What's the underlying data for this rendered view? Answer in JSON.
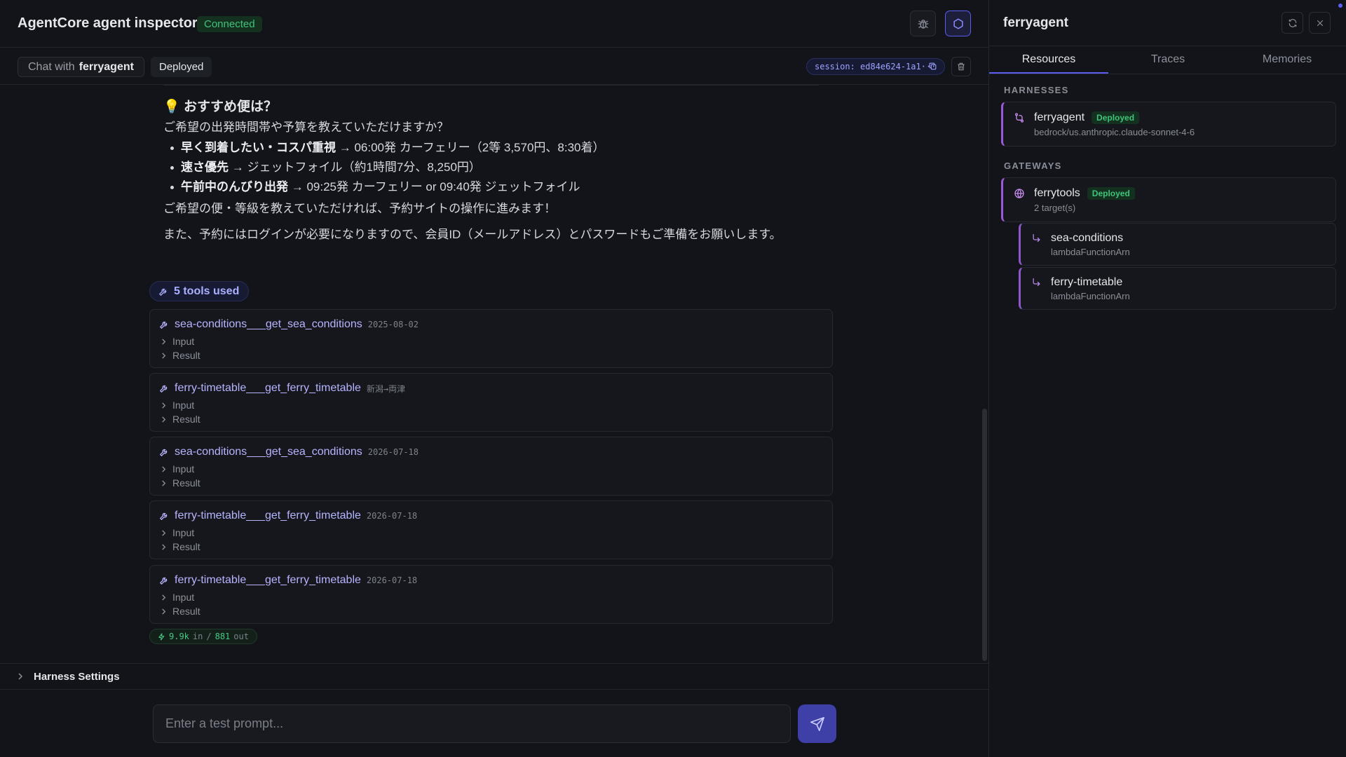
{
  "app": {
    "title": "AgentCore agent inspector",
    "status": "Connected"
  },
  "header": {
    "bug_icon": "bug-icon",
    "panel_icon": "hexagon-icon"
  },
  "chat_header": {
    "chat_with_label": "Chat with",
    "agent_name": "ferryagent",
    "deployed_label": "Deployed",
    "session": "session: ed84e624-1a1···"
  },
  "message": {
    "heading_emoji": "💡",
    "heading": "おすすめ便は？",
    "intro": "ご希望の出発時間帯や予算を教えていただけますか？",
    "options": [
      {
        "bold": "早く到着したい・コスパ重視",
        "rest": " → 06:00発 カーフェリー（2等 3,570円、8:30着）"
      },
      {
        "bold": "速さ優先",
        "rest": " → ジェットフォイル（約1時間7分、8,250円）"
      },
      {
        "bold": "午前中のんびり出発",
        "rest": " → 09:25発 カーフェリー or 09:40発 ジェットフォイル"
      }
    ],
    "followup": "ご希望の便・等級を教えていただければ、予約サイトの操作に進みます！",
    "login_note": "また、予約にはログインが必要になりますので、会員ID（メールアドレス）とパスワードもご準備をお願いします。"
  },
  "tools": {
    "summary": "5 tools used",
    "input_label": "Input",
    "result_label": "Result",
    "items": [
      {
        "name": "sea-conditions___get_sea_conditions",
        "arg": "2025-08-02"
      },
      {
        "name": "ferry-timetable___get_ferry_timetable",
        "arg": "新潟→両津"
      },
      {
        "name": "sea-conditions___get_sea_conditions",
        "arg": "2026-07-18"
      },
      {
        "name": "ferry-timetable___get_ferry_timetable",
        "arg": "2026-07-18"
      },
      {
        "name": "ferry-timetable___get_ferry_timetable",
        "arg": "2026-07-18"
      }
    ]
  },
  "tokens": {
    "in_value": "9.9k",
    "in_label": "in",
    "sep": "/",
    "out_value": "881",
    "out_label": "out"
  },
  "harness_settings": "Harness Settings",
  "composer": {
    "placeholder": "Enter a test prompt..."
  },
  "panel": {
    "title": "ferryagent",
    "tabs": [
      "Resources",
      "Traces",
      "Memories"
    ],
    "active_tab": "Resources",
    "harnesses_label": "HARNESSES",
    "harness": {
      "name": "ferryagent",
      "status": "Deployed",
      "model": "bedrock/us.anthropic.claude-sonnet-4-6"
    },
    "gateways_label": "GATEWAYS",
    "gateway": {
      "name": "ferrytools",
      "status": "Deployed",
      "targets_count": "2 target(s)",
      "targets": [
        {
          "name": "sea-conditions",
          "type": "lambdaFunctionArn"
        },
        {
          "name": "ferry-timetable",
          "type": "lambdaFunctionArn"
        }
      ]
    }
  },
  "colors": {
    "accent": "#5b5cf0",
    "connected": "#3ec47a",
    "tool_name": "#b7b4ff",
    "resource_border": "#9b5bd6"
  }
}
